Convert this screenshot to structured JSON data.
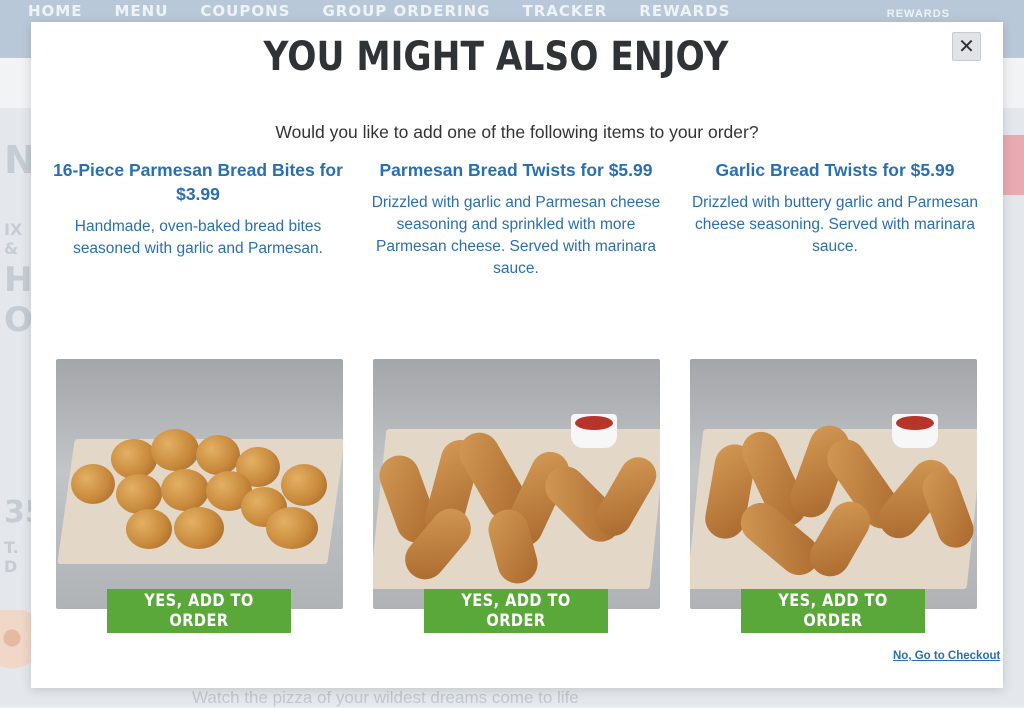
{
  "background": {
    "nav_items": [
      "HOME",
      "MENU",
      "COUPONS",
      "GROUP ORDERING",
      "TRACKER",
      "REWARDS"
    ],
    "nav_right": "REWARDS",
    "side_fragments": [
      "N",
      "IX &",
      "HO",
      "O",
      "35",
      "T. D"
    ],
    "footer_text": "Watch the pizza of your wildest dreams come to life"
  },
  "modal": {
    "title": "YOU MIGHT ALSO ENJOY",
    "close_glyph": "✕",
    "subtitle": "Would you like to add one of the following items to your order?",
    "items": [
      {
        "title": "16-Piece Parmesan Bread Bites for $3.99",
        "description": "Handmade, oven-baked bread bites seasoned with garlic and Parmesan.",
        "button_label": "YES, ADD TO ORDER"
      },
      {
        "title": "Parmesan Bread Twists for $5.99",
        "description": "Drizzled with garlic and Parmesan cheese seasoning and sprinkled with more Parmesan cheese. Served with marinara sauce.",
        "button_label": "YES, ADD TO ORDER"
      },
      {
        "title": "Garlic Bread Twists for $5.99",
        "description": "Drizzled with buttery garlic and Parmesan cheese seasoning. Served with marinara sauce.",
        "button_label": "YES, ADD TO ORDER"
      }
    ],
    "checkout_link": "No, Go to Checkout"
  },
  "colors": {
    "title_text": "#2f3337",
    "item_text": "#2a6fb0",
    "button_bg": "#5aa83a",
    "button_text": "#ffffff"
  }
}
